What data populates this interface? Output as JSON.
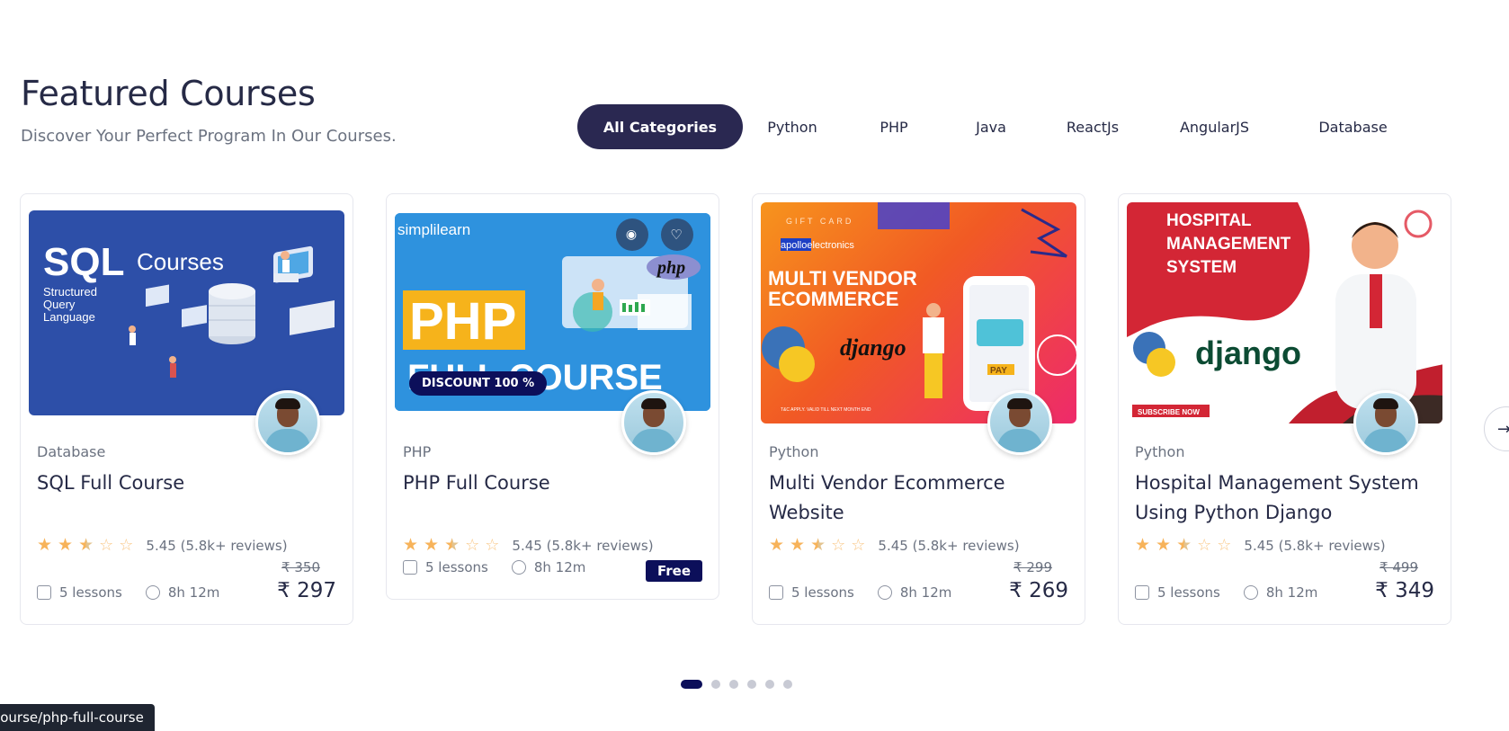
{
  "header": {
    "title": "Featured Courses",
    "subtitle": "Discover Your Perfect Program In Our Courses."
  },
  "tabs": [
    {
      "label": "All Categories",
      "active": true
    },
    {
      "label": "Python"
    },
    {
      "label": "PHP"
    },
    {
      "label": "Java"
    },
    {
      "label": "ReactJs"
    },
    {
      "label": "AngularJS"
    },
    {
      "label": "Database"
    }
  ],
  "courses": [
    {
      "category": "Database",
      "title": "SQL Full Course",
      "rating_text": "5.45 (5.8k+ reviews)",
      "lessons": "5 lessons",
      "duration": "8h 12m",
      "old_price": "₹ 350",
      "price": "₹ 297",
      "thumb": {
        "big": "SQL",
        "word": "Courses",
        "sub1": "Structured",
        "sub2": "Query",
        "sub3": "Language"
      }
    },
    {
      "category": "PHP",
      "title": "PHP Full Course",
      "rating_text": "5.45 (5.8k+ reviews)",
      "lessons": "5 lessons",
      "duration": "8h 12m",
      "badge": "Free",
      "thumb": {
        "brand": "simplilearn",
        "big": "PHP",
        "line2": "FULL COURSE",
        "discount": "DISCOUNT 100 %",
        "logo": "php"
      }
    },
    {
      "category": "Python",
      "title": "Multi Vendor Ecommerce Website",
      "rating_text": "5.45 (5.8k+ reviews)",
      "lessons": "5 lessons",
      "duration": "8h 12m",
      "old_price": "₹ 299",
      "price": "₹ 269",
      "thumb": {
        "small": "GIFT CARD",
        "brand": "apolloelectronics",
        "line1": "MULTI VENDOR",
        "line2": "ECOMMERCE",
        "django": "django",
        "pay": "PAY",
        "fine": "T&C APPLY. VALID TILL NEXT MONTH END"
      }
    },
    {
      "category": "Python",
      "title": "Hospital Management System Using Python Django",
      "rating_text": "5.45 (5.8k+ reviews)",
      "lessons": "5 lessons",
      "duration": "8h 12m",
      "old_price": "₹ 499",
      "price": "₹ 349",
      "thumb": {
        "line1": "HOSPITAL",
        "line2": "MANAGEMENT",
        "line3": "SYSTEM",
        "django": "django",
        "subscribe": "SUBSCRIBE NOW"
      }
    }
  ],
  "rating": {
    "full": 2,
    "half": 1,
    "empty": 2
  },
  "pagination": {
    "count": 6,
    "active": 0
  },
  "tooltip": "course/php-full-course",
  "icons": {
    "lessons": "box-icon",
    "duration": "clock-icon",
    "preview": "eye-icon",
    "wishlist": "heart-icon",
    "next": "arrow-right-icon"
  },
  "colors": {
    "primary": "#2a2851",
    "accent": "#0c0f5a",
    "star": "#f7b35a"
  }
}
